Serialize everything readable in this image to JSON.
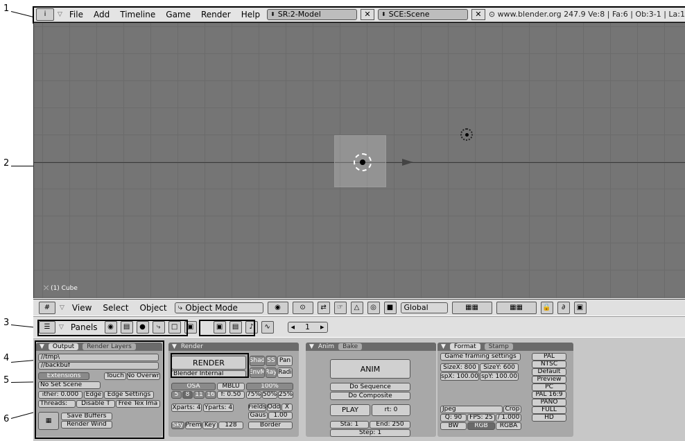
{
  "annotations": [
    "1",
    "2",
    "3",
    "4",
    "5",
    "6"
  ],
  "topbar": {
    "info_icon": "i",
    "menus": [
      "File",
      "Add",
      "Timeline",
      "Game",
      "Render",
      "Help"
    ],
    "screen_field": "SR:2-Model",
    "scene_field": "SCE:Scene",
    "stats": "www.blender.org 247.9  Ve:8 | Fa:6 | Ob:3-1 | La:1"
  },
  "viewport": {
    "object_label": "(1) Cube"
  },
  "view3d_header": {
    "menus": [
      "View",
      "Select",
      "Object"
    ],
    "mode": "Object Mode",
    "orientation": "Global"
  },
  "buttons_header": {
    "panels_label": "Panels",
    "frame": "1"
  },
  "output_panel": {
    "tab1": "Output",
    "tab2": "Render Layers",
    "path1": "//tmp\\",
    "path2": "//backbuf",
    "extensions": "Extensions",
    "touch": "Touch",
    "no_overwrite": "No Overwri",
    "no_set_scene": "No Set Scene",
    "dither": "ither: 0.000",
    "edge": "Edge",
    "edge_settings": "Edge Settings",
    "threads": "Threads:",
    "disable_t": "Disable T",
    "free_tex": "Free Tex Ima",
    "save_buffers": "Save Buffers",
    "render_window": "Render Wind"
  },
  "render_panel": {
    "title": "Render",
    "render_btn": "RENDER",
    "renderer": "Blender Internal",
    "shad": "Shad",
    "ss": "SS",
    "pan": "Pan",
    "envmap": "EnvM",
    "ray": "Ray",
    "radio": "Radi",
    "osa": "OSA",
    "mblur": "MBLU",
    "percent": "100%",
    "osa5": "5",
    "osa8": "8",
    "osa11": "11",
    "osa16": "16",
    "f_val": "f: 0.50",
    "p75": "75%",
    "p50": "50%",
    "p25": "25%",
    "xparts": "Xparts: 4",
    "yparts": "Yparts: 4",
    "fields": "Fields",
    "odd": "Odd",
    "x": "X",
    "gauss": "Gaus",
    "gauss_val": "1.00",
    "sky": "Sky",
    "premul": "Prem",
    "key": "Key",
    "bits": "128",
    "border": "Border"
  },
  "anim_panel": {
    "tab1": "Anim",
    "tab2": "Bake",
    "anim": "ANIM",
    "do_sequence": "Do Sequence",
    "do_composite": "Do Composite",
    "play": "PLAY",
    "rt": "rt: 0",
    "sta": "Sta: 1",
    "end": "End: 250",
    "step": "Step: 1"
  },
  "format_panel": {
    "tab1": "Format",
    "tab2": "Stamp",
    "game_framing": "Game framing settings",
    "sizex": "SizeX: 800",
    "sizey": "SizeY: 600",
    "aspx": "spX: 100.00",
    "aspy": "spY: 100.00",
    "presets": [
      "PAL",
      "NTSC",
      "Default",
      "Preview",
      "PC",
      "PAL 16:9",
      "PANO",
      "FULL",
      "HD"
    ],
    "format": "Jpeg",
    "crop": "Crop",
    "quality": "Q: 90",
    "fps": "FPS: 25",
    "fps_base": "/ 1.000",
    "bw": "BW",
    "rgb": "RGB",
    "rgba": "RGBA"
  }
}
